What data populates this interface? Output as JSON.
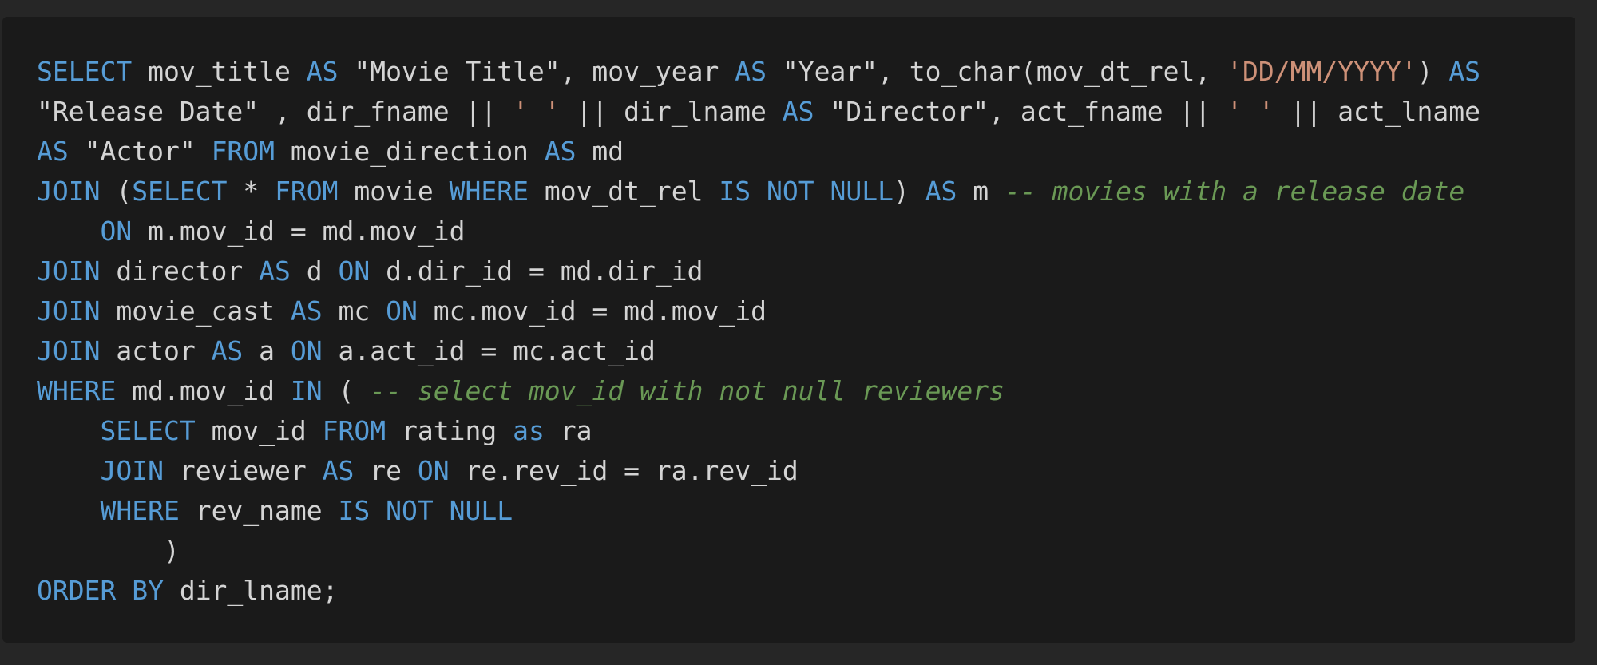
{
  "colors": {
    "background": "#262626",
    "panel": "#1a1a1a",
    "plain": "#d4d4d4",
    "keyword": "#569cd6",
    "string": "#ce9178",
    "comment": "#6a9955"
  },
  "code": {
    "language": "sql",
    "lines": [
      [
        {
          "t": "kw",
          "v": "SELECT"
        },
        {
          "t": "p",
          "v": " mov_title "
        },
        {
          "t": "kw",
          "v": "AS"
        },
        {
          "t": "p",
          "v": " \"Movie Title\", mov_year "
        },
        {
          "t": "kw",
          "v": "AS"
        },
        {
          "t": "p",
          "v": " \"Year\", to_char(mov_dt_rel, "
        },
        {
          "t": "str",
          "v": "'DD/MM/YYYY'"
        },
        {
          "t": "p",
          "v": ") "
        },
        {
          "t": "kw",
          "v": "AS"
        }
      ],
      [
        {
          "t": "p",
          "v": "\"Release Date\" , dir_fname || "
        },
        {
          "t": "str",
          "v": "' '"
        },
        {
          "t": "p",
          "v": " || dir_lname "
        },
        {
          "t": "kw",
          "v": "AS"
        },
        {
          "t": "p",
          "v": " \"Director\", act_fname || "
        },
        {
          "t": "str",
          "v": "' '"
        },
        {
          "t": "p",
          "v": " || act_lname"
        }
      ],
      [
        {
          "t": "kw",
          "v": "AS"
        },
        {
          "t": "p",
          "v": " \"Actor\" "
        },
        {
          "t": "kw",
          "v": "FROM"
        },
        {
          "t": "p",
          "v": " movie_direction "
        },
        {
          "t": "kw",
          "v": "AS"
        },
        {
          "t": "p",
          "v": " md"
        }
      ],
      [
        {
          "t": "kw",
          "v": "JOIN"
        },
        {
          "t": "p",
          "v": " ("
        },
        {
          "t": "kw",
          "v": "SELECT"
        },
        {
          "t": "p",
          "v": " * "
        },
        {
          "t": "kw",
          "v": "FROM"
        },
        {
          "t": "p",
          "v": " movie "
        },
        {
          "t": "kw",
          "v": "WHERE"
        },
        {
          "t": "p",
          "v": " mov_dt_rel "
        },
        {
          "t": "kw",
          "v": "IS NOT NULL"
        },
        {
          "t": "p",
          "v": ") "
        },
        {
          "t": "kw",
          "v": "AS"
        },
        {
          "t": "p",
          "v": " m "
        },
        {
          "t": "cm",
          "v": "-- movies with a release date"
        }
      ],
      [
        {
          "t": "p",
          "v": "    "
        },
        {
          "t": "kw",
          "v": "ON"
        },
        {
          "t": "p",
          "v": " m.mov_id = md.mov_id"
        }
      ],
      [
        {
          "t": "kw",
          "v": "JOIN"
        },
        {
          "t": "p",
          "v": " director "
        },
        {
          "t": "kw",
          "v": "AS"
        },
        {
          "t": "p",
          "v": " d "
        },
        {
          "t": "kw",
          "v": "ON"
        },
        {
          "t": "p",
          "v": " d.dir_id = md.dir_id"
        }
      ],
      [
        {
          "t": "kw",
          "v": "JOIN"
        },
        {
          "t": "p",
          "v": " movie_cast "
        },
        {
          "t": "kw",
          "v": "AS"
        },
        {
          "t": "p",
          "v": " mc "
        },
        {
          "t": "kw",
          "v": "ON"
        },
        {
          "t": "p",
          "v": " mc.mov_id = md.mov_id"
        }
      ],
      [
        {
          "t": "kw",
          "v": "JOIN"
        },
        {
          "t": "p",
          "v": " actor "
        },
        {
          "t": "kw",
          "v": "AS"
        },
        {
          "t": "p",
          "v": " a "
        },
        {
          "t": "kw",
          "v": "ON"
        },
        {
          "t": "p",
          "v": " a.act_id = mc.act_id"
        }
      ],
      [
        {
          "t": "kw",
          "v": "WHERE"
        },
        {
          "t": "p",
          "v": " md.mov_id "
        },
        {
          "t": "kw",
          "v": "IN"
        },
        {
          "t": "p",
          "v": " ( "
        },
        {
          "t": "cm",
          "v": "-- select mov_id with not null reviewers"
        }
      ],
      [
        {
          "t": "p",
          "v": "    "
        },
        {
          "t": "kw",
          "v": "SELECT"
        },
        {
          "t": "p",
          "v": " mov_id "
        },
        {
          "t": "kw",
          "v": "FROM"
        },
        {
          "t": "p",
          "v": " rating "
        },
        {
          "t": "kw",
          "v": "as"
        },
        {
          "t": "p",
          "v": " ra"
        }
      ],
      [
        {
          "t": "p",
          "v": "    "
        },
        {
          "t": "kw",
          "v": "JOIN"
        },
        {
          "t": "p",
          "v": " reviewer "
        },
        {
          "t": "kw",
          "v": "AS"
        },
        {
          "t": "p",
          "v": " re "
        },
        {
          "t": "kw",
          "v": "ON"
        },
        {
          "t": "p",
          "v": " re.rev_id = ra.rev_id"
        }
      ],
      [
        {
          "t": "p",
          "v": "    "
        },
        {
          "t": "kw",
          "v": "WHERE"
        },
        {
          "t": "p",
          "v": " rev_name "
        },
        {
          "t": "kw",
          "v": "IS NOT NULL"
        }
      ],
      [
        {
          "t": "p",
          "v": "        )"
        }
      ],
      [
        {
          "t": "kw",
          "v": "ORDER BY"
        },
        {
          "t": "p",
          "v": " dir_lname;"
        }
      ]
    ]
  }
}
